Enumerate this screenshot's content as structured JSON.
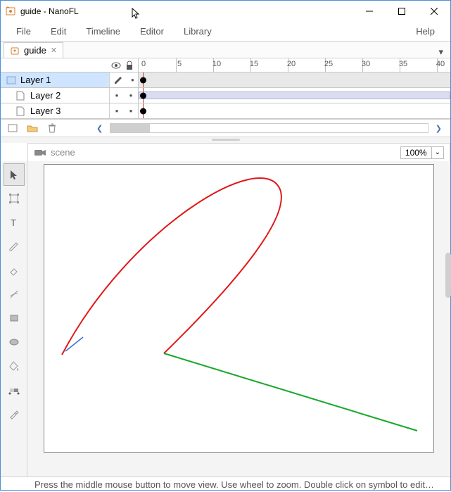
{
  "window": {
    "title": "guide - NanoFL"
  },
  "menu": {
    "file": "File",
    "edit": "Edit",
    "timeline": "Timeline",
    "editor": "Editor",
    "library": "Library",
    "help": "Help"
  },
  "doctab": {
    "name": "guide"
  },
  "timeline": {
    "frame0": "0",
    "ticks": [
      "5",
      "10",
      "15",
      "20",
      "25",
      "30",
      "35",
      "40"
    ],
    "layers": [
      {
        "name": "Layer 1",
        "selected": true,
        "tween": false
      },
      {
        "name": "Layer 2",
        "selected": false,
        "tween": true
      },
      {
        "name": "Layer 3",
        "selected": false,
        "tween": false
      }
    ]
  },
  "scene": {
    "name": "scene",
    "zoom": "100%"
  },
  "status": {
    "text": "Press the middle mouse button to move view. Use wheel to zoom. Double click on symbol to edit…"
  }
}
